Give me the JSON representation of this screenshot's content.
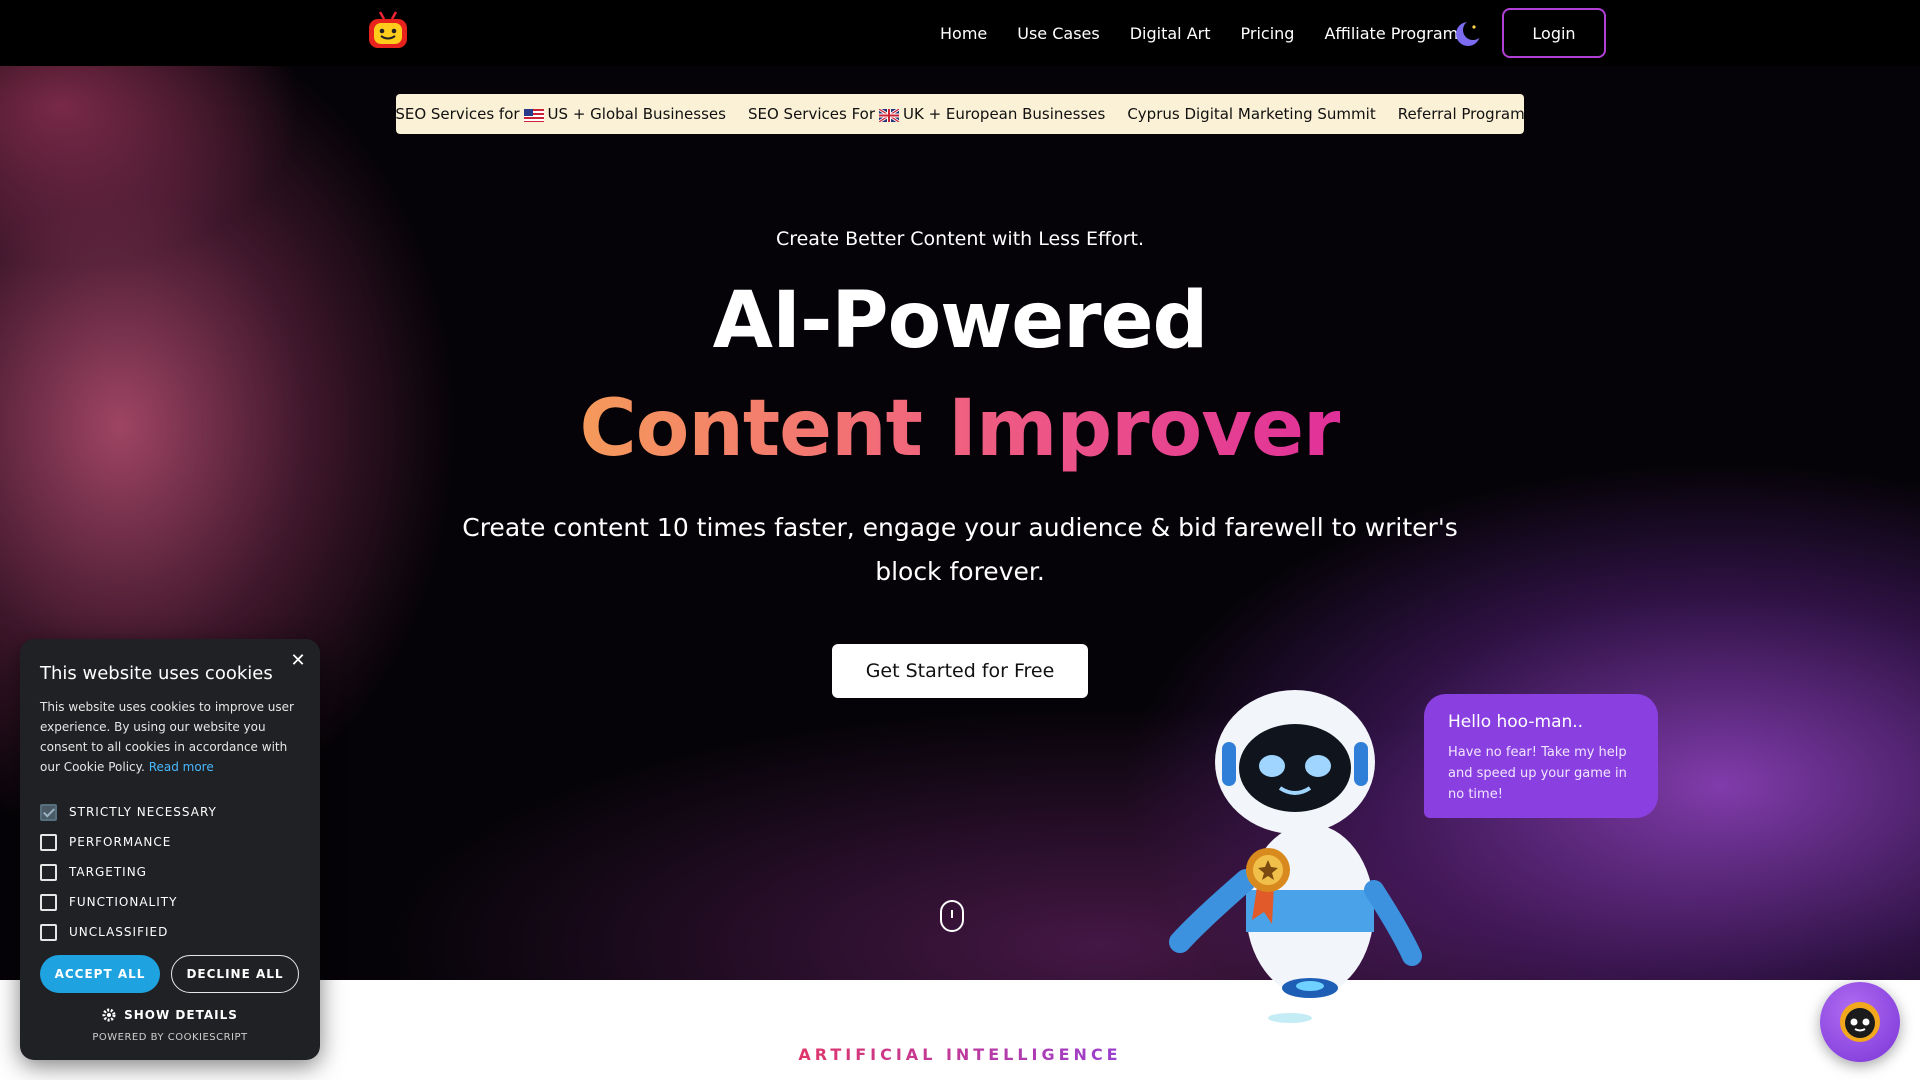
{
  "nav": {
    "logo_icon": "robot-tv-logo-icon",
    "items": [
      {
        "label": "Home"
      },
      {
        "label": "Use Cases"
      },
      {
        "label": "Digital Art"
      },
      {
        "label": "Pricing"
      },
      {
        "label": "Affiliate Program"
      }
    ],
    "theme_icon": "moon-icon",
    "login_label": "Login"
  },
  "announce": {
    "items": [
      {
        "before": "SEO Services for",
        "flag": "us-flag-icon",
        "after": "US + Global Businesses"
      },
      {
        "before": "SEO Services For",
        "flag": "uk-flag-icon",
        "after": "UK + European Businesses"
      },
      {
        "before": "Cyprus Digital Marketing Summit",
        "flag": "",
        "after": ""
      },
      {
        "before": "Referral Program",
        "flag": "",
        "after": ""
      }
    ]
  },
  "hero": {
    "eyebrow": "Create Better Content with Less Effort.",
    "headline_line1": "AI-Powered",
    "headline_line2": "Content Improver",
    "subline": "Create content 10 times faster, engage your audience & bid farewell to writer's block forever.",
    "cta_label": "Get Started for Free",
    "scroll_icon": "mouse-scroll-icon"
  },
  "bubble": {
    "title": "Hello hoo-man..",
    "text": "Have no fear! Take my help and speed up your game in no time!"
  },
  "section": {
    "label": "ARTIFICIAL INTELLIGENCE"
  },
  "cookie": {
    "title": "This website uses cookies",
    "description": "This website uses cookies to improve user experience. By using our website you consent to all cookies in accordance with our Cookie Policy.",
    "read_more": "Read more",
    "options": [
      {
        "label": "STRICTLY NECESSARY",
        "checked": true
      },
      {
        "label": "PERFORMANCE",
        "checked": false
      },
      {
        "label": "TARGETING",
        "checked": false
      },
      {
        "label": "FUNCTIONALITY",
        "checked": false
      },
      {
        "label": "UNCLASSIFIED",
        "checked": false
      }
    ],
    "accept_label": "ACCEPT ALL",
    "decline_label": "DECLINE ALL",
    "details_label": "SHOW DETAILS",
    "powered_by": "POWERED BY COOKIESCRIPT",
    "close_icon": "close-icon"
  },
  "colors": {
    "accent_purple": "#8a3fe0",
    "login_border": "#b23fd6",
    "cookie_accept": "#1ea3e0",
    "announce_bg": "#fbf1d6"
  }
}
